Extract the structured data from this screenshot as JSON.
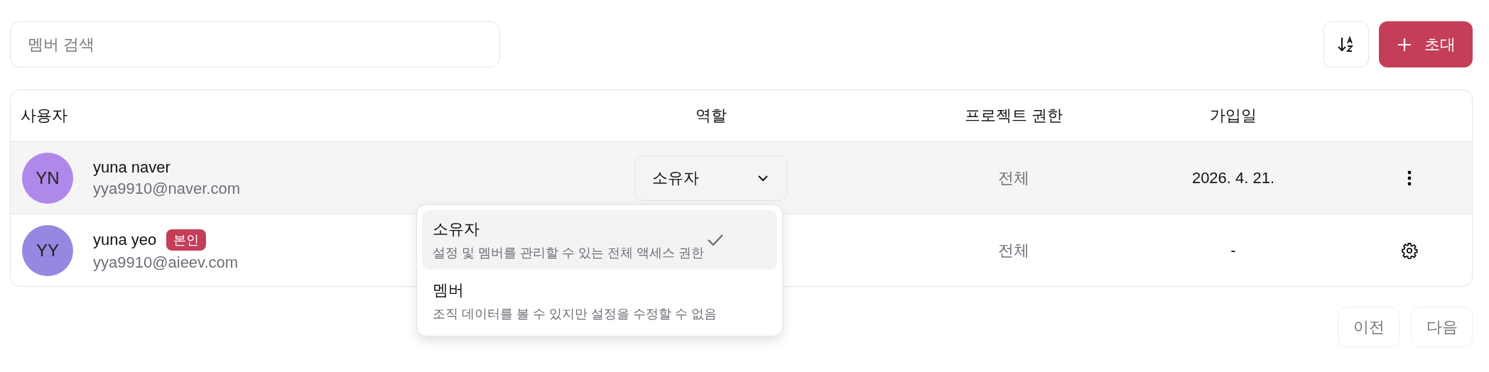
{
  "search": {
    "placeholder": "멤버 검색"
  },
  "toolbar": {
    "sort_button": {
      "kind": "sort"
    },
    "invite_button": {
      "label": "초대"
    }
  },
  "table": {
    "columns": [
      "사용자",
      "역할",
      "프로젝트 권한",
      "가입일"
    ],
    "rows": [
      {
        "initials": "YN",
        "color": "#b088ea",
        "name": "yuna naver",
        "badge": null,
        "email": "yya9910@naver.com",
        "role": "소유자",
        "project_access": "전체",
        "joined": "2026. 4. 21.",
        "kind": "more",
        "role_menu": {
          "items": [
            {
              "label": "소유자",
              "description": "설정 및 멤버를 관리할 수 있는 전체 액세스 권한",
              "selected": true
            },
            {
              "label": "멤버",
              "description": "조직 데이터를 볼 수 있지만 설정을 수정할 수 없음",
              "selected": false
            }
          ]
        }
      },
      {
        "initials": "YY",
        "color": "#9488e0",
        "name": "yuna yeo",
        "badge": "본인",
        "email": "yya9910@aieev.com",
        "project_access": "전체",
        "joined": "-",
        "kind": "settings"
      }
    ]
  },
  "pagination": {
    "buttons": [
      "이전",
      "다음"
    ]
  }
}
